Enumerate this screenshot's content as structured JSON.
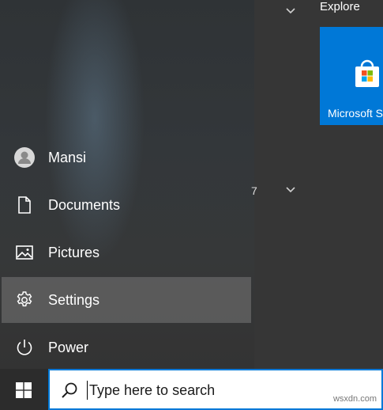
{
  "start_menu": {
    "user": {
      "label": "Mansi",
      "icon": "user-avatar-icon"
    },
    "items": [
      {
        "label": "Documents",
        "icon": "document-icon"
      },
      {
        "label": "Pictures",
        "icon": "pictures-icon"
      },
      {
        "label": "Settings",
        "icon": "gear-icon",
        "active": true
      },
      {
        "label": "Power",
        "icon": "power-icon"
      }
    ],
    "colors": {
      "active_bg": "#6b6b6b",
      "panel_bg": "#333333"
    }
  },
  "tiles": {
    "group_title": "Explore",
    "section_number": "7",
    "store_tile": {
      "label": "Microsoft S",
      "icon": "microsoft-store-icon",
      "color": "#0078d7"
    }
  },
  "taskbar": {
    "start_icon": "windows-logo-icon",
    "search": {
      "placeholder": "Type here to search",
      "icon": "search-icon",
      "border_color": "#0078d7"
    }
  },
  "watermark": "wsxdn.com"
}
